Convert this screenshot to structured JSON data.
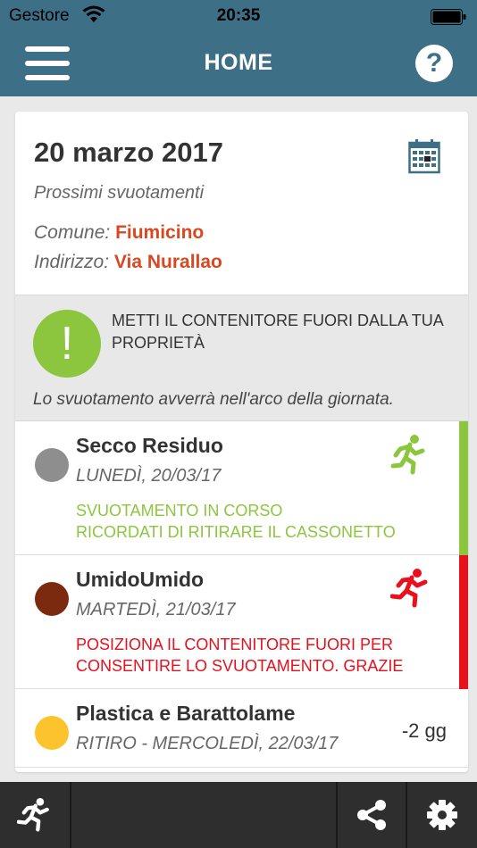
{
  "status_bar": {
    "carrier": "Gestore",
    "time": "20:35"
  },
  "nav": {
    "title": "HOME",
    "help_label": "?"
  },
  "card": {
    "date": "20 marzo 2017",
    "subtitle": "Prossimi svuotamenti",
    "comune_label": "Comune:",
    "comune_value": "Fiumicino",
    "indirizzo_label": "Indirizzo:",
    "indirizzo_value": "Via Nurallao"
  },
  "notice": {
    "icon_text": "!",
    "text": "METTI IL CONTENITORE FUORI DALLA TUA PROPRIETÀ",
    "subtext": "Lo svuotamento avverrà nell'arco della giornata."
  },
  "items": [
    {
      "name": "Secco Residuo",
      "when": "LUNEDÌ, 20/03/17",
      "msg_line1": "SVUOTAMENTO IN CORSO",
      "msg_line2": "RICORDATI DI RITIRARE IL CASSONETTO",
      "dot_color": "#8e8e8e",
      "msg_color": "#8cc63f",
      "bar_color": "#8cc63f",
      "icon": "runner-icon"
    },
    {
      "name": "UmidoUmido",
      "when": "MARTEDÌ, 21/03/17",
      "msg_line1": "POSIZIONA IL CONTENITORE FUORI PER",
      "msg_line2": "CONSENTIRE LO SVUOTAMENTO. GRAZIE",
      "dot_color": "#7b2a10",
      "msg_color": "#e8101c",
      "bar_color": "#e8101c",
      "icon": "runner-icon"
    },
    {
      "name": "Plastica e Barattolame",
      "when": "RITIRO - MERCOLEDÌ, 22/03/17",
      "days": "-2 gg",
      "dot_color": "#fcc32d"
    }
  ],
  "colors": {
    "header": "#3d6f86",
    "accent_orange": "#d9481f",
    "green": "#8cc63f",
    "red": "#e8101c",
    "toolbar": "#2e2e2e"
  },
  "toolbar": {
    "icons": [
      "runner-icon",
      "share-icon",
      "gear-icon"
    ]
  }
}
